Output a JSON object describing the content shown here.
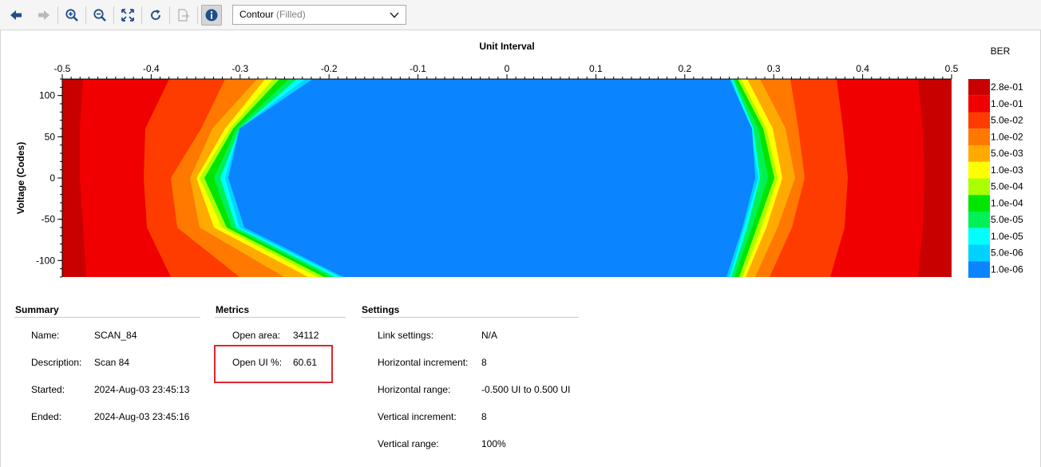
{
  "toolbar": {
    "buttons": [
      {
        "name": "back-button",
        "icon": "arrow-left-icon",
        "enabled": true
      },
      {
        "name": "forward-button",
        "icon": "arrow-right-icon",
        "enabled": false
      },
      {
        "name": "zoom-in-button",
        "icon": "zoom-in-icon",
        "enabled": true
      },
      {
        "name": "zoom-out-button",
        "icon": "zoom-out-icon",
        "enabled": true
      },
      {
        "name": "fit-button",
        "icon": "fit-to-window-icon",
        "enabled": true
      },
      {
        "name": "refresh-button",
        "icon": "refresh-icon",
        "enabled": true
      },
      {
        "name": "export-button",
        "icon": "export-icon",
        "enabled": false
      },
      {
        "name": "info-button",
        "icon": "info-icon",
        "enabled": true
      }
    ],
    "plot_type": {
      "selected": "Contour",
      "qualifier": "(Filled)"
    }
  },
  "chart_data": {
    "type": "heatmap",
    "title": "Unit Interval",
    "xlabel": "Unit Interval",
    "ylabel": "Voltage (Codes)",
    "xlim": [
      -0.5,
      0.5
    ],
    "ylim": [
      -120,
      120
    ],
    "x_ticks": [
      "-0.5",
      "-0.4",
      "-0.3",
      "-0.2",
      "-0.1",
      "0",
      "0.1",
      "0.2",
      "0.3",
      "0.4",
      "0.5"
    ],
    "y_ticks": [
      "100",
      "50",
      "0",
      "-50",
      "-100"
    ],
    "legend_title": "BER",
    "levels": [
      {
        "label": "2.8e-01",
        "color": "#c80000"
      },
      {
        "label": "1.0e-01",
        "color": "#f00000"
      },
      {
        "label": "5.0e-02",
        "color": "#ff3c00"
      },
      {
        "label": "1.0e-02",
        "color": "#ff7800"
      },
      {
        "label": "5.0e-03",
        "color": "#ffaa00"
      },
      {
        "label": "1.0e-03",
        "color": "#ffff00"
      },
      {
        "label": "5.0e-04",
        "color": "#aaff00"
      },
      {
        "label": "1.0e-04",
        "color": "#00e600"
      },
      {
        "label": "5.0e-05",
        "color": "#00f058"
      },
      {
        "label": "1.0e-05",
        "color": "#00ffff"
      },
      {
        "label": "5.0e-06",
        "color": "#00d2ff"
      },
      {
        "label": "1.0e-06",
        "color": "#0a84ff"
      }
    ],
    "open_region_x": [
      -0.31,
      0.25
    ]
  },
  "summary": {
    "title": "Summary",
    "rows": [
      {
        "label": "Name:",
        "value": "SCAN_84"
      },
      {
        "label": "Description:",
        "value": "Scan 84"
      },
      {
        "label": "Started:",
        "value": "2024-Aug-03 23:45:13"
      },
      {
        "label": "Ended:",
        "value": "2024-Aug-03 23:45:16"
      }
    ]
  },
  "metrics": {
    "title": "Metrics",
    "rows": [
      {
        "label": "Open area:",
        "value": "34112"
      },
      {
        "label": "Open UI %:",
        "value": "60.61"
      }
    ]
  },
  "settings": {
    "title": "Settings",
    "rows": [
      {
        "label": "Link settings:",
        "value": "N/A"
      },
      {
        "label": "Horizontal increment:",
        "value": "8"
      },
      {
        "label": "Horizontal range:",
        "value": "-0.500 UI to 0.500 UI"
      },
      {
        "label": "Vertical increment:",
        "value": "8"
      },
      {
        "label": "Vertical range:",
        "value": "100%"
      }
    ]
  }
}
